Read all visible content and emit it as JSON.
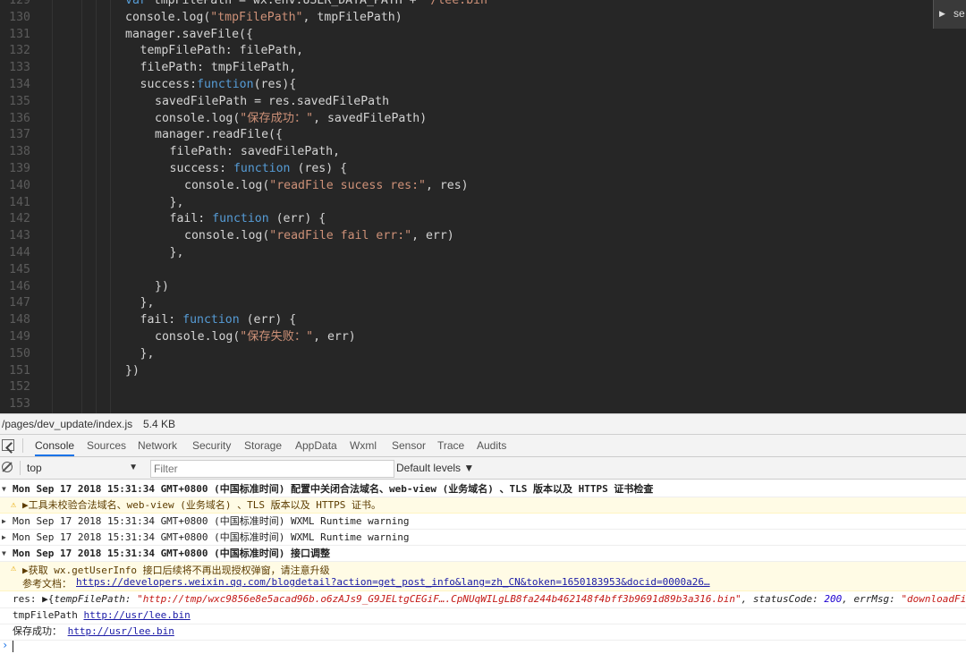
{
  "editor": {
    "lines": [
      {
        "n": "129",
        "indent": 0,
        "tokens": [
          {
            "t": "kw",
            "v": "var "
          },
          {
            "t": "plain",
            "v": "tmpFilePath = wx.env.USER_DATA_PATH + "
          },
          {
            "t": "str",
            "v": "\"/lee.bin\""
          }
        ]
      },
      {
        "n": "130",
        "indent": 0,
        "tokens": [
          {
            "t": "plain",
            "v": "console.log("
          },
          {
            "t": "str",
            "v": "\"tmpFilePath\""
          },
          {
            "t": "plain",
            "v": ", tmpFilePath)"
          }
        ]
      },
      {
        "n": "131",
        "indent": 0,
        "tokens": [
          {
            "t": "plain",
            "v": "manager.saveFile({"
          }
        ]
      },
      {
        "n": "132",
        "indent": 1,
        "tokens": [
          {
            "t": "plain",
            "v": "tempFilePath: filePath,"
          }
        ]
      },
      {
        "n": "133",
        "indent": 1,
        "tokens": [
          {
            "t": "plain",
            "v": "filePath: tmpFilePath,"
          }
        ]
      },
      {
        "n": "134",
        "indent": 1,
        "tokens": [
          {
            "t": "plain",
            "v": "success:"
          },
          {
            "t": "kw",
            "v": "function"
          },
          {
            "t": "plain",
            "v": "(res){"
          }
        ]
      },
      {
        "n": "135",
        "indent": 2,
        "tokens": [
          {
            "t": "plain",
            "v": "savedFilePath = res.savedFilePath"
          }
        ]
      },
      {
        "n": "136",
        "indent": 2,
        "tokens": [
          {
            "t": "plain",
            "v": "console.log("
          },
          {
            "t": "str",
            "v": "\"保存成功：\""
          },
          {
            "t": "plain",
            "v": ", savedFilePath)"
          }
        ]
      },
      {
        "n": "137",
        "indent": 2,
        "tokens": [
          {
            "t": "plain",
            "v": "manager.readFile({"
          }
        ]
      },
      {
        "n": "138",
        "indent": 3,
        "tokens": [
          {
            "t": "plain",
            "v": "filePath: savedFilePath,"
          }
        ]
      },
      {
        "n": "139",
        "indent": 3,
        "tokens": [
          {
            "t": "plain",
            "v": "success: "
          },
          {
            "t": "kw",
            "v": "function"
          },
          {
            "t": "plain",
            "v": " (res) {"
          }
        ]
      },
      {
        "n": "140",
        "indent": 4,
        "tokens": [
          {
            "t": "plain",
            "v": "console.log("
          },
          {
            "t": "str",
            "v": "\"readFile sucess res:\""
          },
          {
            "t": "plain",
            "v": ", res)"
          }
        ]
      },
      {
        "n": "141",
        "indent": 3,
        "tokens": [
          {
            "t": "plain",
            "v": "},"
          }
        ]
      },
      {
        "n": "142",
        "indent": 3,
        "tokens": [
          {
            "t": "plain",
            "v": "fail: "
          },
          {
            "t": "kw",
            "v": "function"
          },
          {
            "t": "plain",
            "v": " (err) {"
          }
        ]
      },
      {
        "n": "143",
        "indent": 4,
        "tokens": [
          {
            "t": "plain",
            "v": "console.log("
          },
          {
            "t": "str",
            "v": "\"readFile fail err:\""
          },
          {
            "t": "plain",
            "v": ", err)"
          }
        ]
      },
      {
        "n": "144",
        "indent": 3,
        "tokens": [
          {
            "t": "plain",
            "v": "},"
          }
        ]
      },
      {
        "n": "145",
        "indent": 0,
        "tokens": []
      },
      {
        "n": "146",
        "indent": 2,
        "tokens": [
          {
            "t": "plain",
            "v": "})"
          }
        ]
      },
      {
        "n": "147",
        "indent": 1,
        "tokens": [
          {
            "t": "plain",
            "v": "},"
          }
        ]
      },
      {
        "n": "148",
        "indent": 1,
        "tokens": [
          {
            "t": "plain",
            "v": "fail: "
          },
          {
            "t": "kw",
            "v": "function"
          },
          {
            "t": "plain",
            "v": " (err) {"
          }
        ]
      },
      {
        "n": "149",
        "indent": 2,
        "tokens": [
          {
            "t": "plain",
            "v": "console.log("
          },
          {
            "t": "str",
            "v": "\"保存失败：\""
          },
          {
            "t": "plain",
            "v": ", err)"
          }
        ]
      },
      {
        "n": "150",
        "indent": 1,
        "tokens": [
          {
            "t": "plain",
            "v": "},"
          }
        ]
      },
      {
        "n": "151",
        "indent": 0,
        "tokens": [
          {
            "t": "plain",
            "v": "})"
          }
        ]
      },
      {
        "n": "152",
        "indent": 0,
        "tokens": []
      },
      {
        "n": "153",
        "indent": 0,
        "tokens": []
      }
    ],
    "mini_panel_label": "se"
  },
  "status": {
    "path": "/pages/dev_update/index.js",
    "size": "5.4 KB"
  },
  "devtools": {
    "tabs": [
      "Console",
      "Sources",
      "Network",
      "Security",
      "Storage",
      "AppData",
      "Wxml",
      "Sensor",
      "Trace",
      "Audits"
    ],
    "active_tab": "Console",
    "context": "top",
    "filter_placeholder": "Filter",
    "levels": "Default levels ▼"
  },
  "console": {
    "group1_header": "Mon Sep 17 2018 15:31:34 GMT+0800 (中国标准时间) 配置中关闭合法域名、web-view (业务域名) 、TLS 版本以及 HTTPS 证书检查",
    "group1_warn": "▶工具未校验合法域名、web-view (业务域名) 、TLS 版本以及 HTTPS 证书。",
    "warn_line2": "Mon Sep 17 2018 15:31:34 GMT+0800 (中国标准时间) WXML Runtime warning",
    "warn_line3": "Mon Sep 17 2018 15:31:34 GMT+0800 (中国标准时间) WXML Runtime warning",
    "group2_header": "Mon Sep 17 2018 15:31:34 GMT+0800 (中国标准时间) 接口调整",
    "group2_warn_line1": "▶获取 wx.getUserInfo 接口后续将不再出现授权弹窗，请注意升级",
    "group2_warn_doc_label": "参考文档：",
    "group2_warn_doc_link": "https://developers.weixin.qq.com/blogdetail?action=get_post_info&lang=zh_CN&token=1650183953&docid=0000a26…",
    "res_label": "res: ",
    "res_open": "▶{",
    "res_key1": "tempFilePath: ",
    "res_val1": "\"http://tmp/wxc9856e8e5acad96b.o6zAJs9_G9JELtgCEGiF….CpNUqWILgLB8fa244b462148f4bff3b9691d89b3a316.bin\"",
    "res_key2": ", statusCode: ",
    "res_val2": "200",
    "res_key3": ", errMsg: ",
    "res_val3": "\"downloadFile:ok\"",
    "res_close": "}",
    "tmp_label": "tmpFilePath ",
    "tmp_link": "http://usr/lee.bin",
    "saved_label": "保存成功：  ",
    "saved_link": "http://usr/lee.bin",
    "prompt": "›"
  }
}
